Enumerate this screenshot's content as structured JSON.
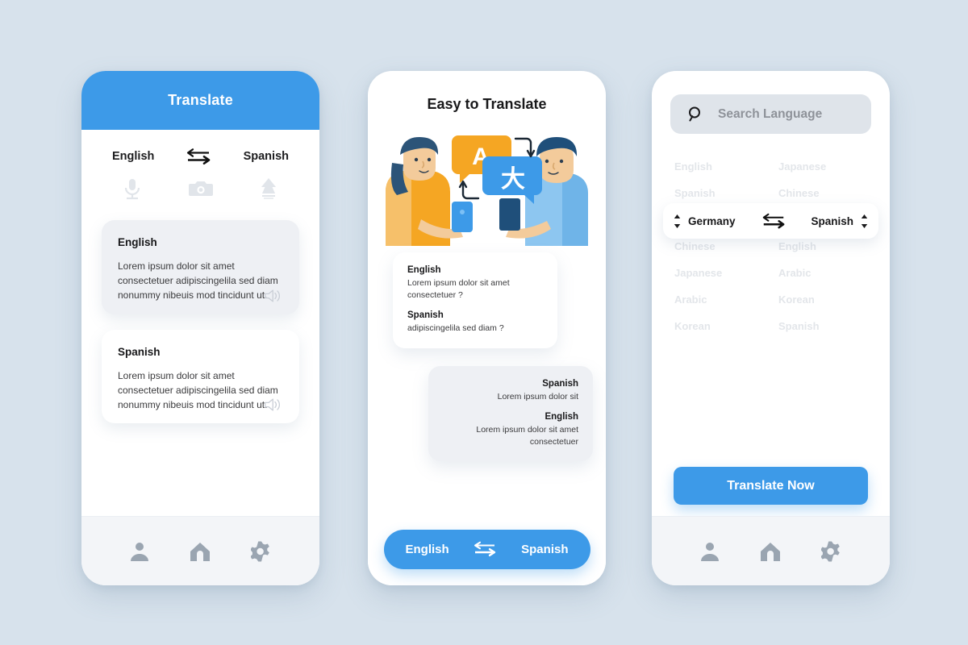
{
  "theme": {
    "background": "#d7e2ec",
    "accent_blue": "#3d9ae8",
    "card_grey": "#eef0f4",
    "muted_text": "#e3e6ea"
  },
  "phone1": {
    "header_title": "Translate",
    "source_language": "English",
    "target_language": "Spanish",
    "swap_icon": "swap-arrows-icon",
    "tools": [
      {
        "icon": "microphone-icon",
        "name": "voice-input"
      },
      {
        "icon": "camera-icon",
        "name": "camera-input"
      },
      {
        "icon": "pen-icon",
        "name": "handwriting-input"
      }
    ],
    "cards": [
      {
        "language": "English",
        "text": "Lorem ipsum dolor sit amet consectetuer adipiscingelila sed diam nonummy nibeuis mod tincidunt ut.",
        "speaker_icon": "speaker-icon",
        "style": "grey"
      },
      {
        "language": "Spanish",
        "text": "Lorem ipsum dolor sit amet consectetuer adipiscingelila sed diam nonummy nibeuis mod tincidunt ut.",
        "speaker_icon": "speaker-icon",
        "style": "white"
      }
    ],
    "nav": [
      {
        "icon": "profile-icon",
        "name": "nav-profile"
      },
      {
        "icon": "home-icon",
        "name": "nav-home"
      },
      {
        "icon": "gear-icon",
        "name": "nav-settings"
      }
    ]
  },
  "phone2": {
    "title": "Easy to Translate",
    "illustration": {
      "name": "two-people-translating-illustration",
      "bubble_left_letter": "A",
      "bubble_right_letter": "大"
    },
    "bubbles": [
      {
        "align": "left",
        "entries": [
          {
            "language": "English",
            "text": "Lorem ipsum dolor sit amet consectetuer ?"
          },
          {
            "language": "Spanish",
            "text": "adipiscingelila sed diam ?"
          }
        ]
      },
      {
        "align": "right",
        "entries": [
          {
            "language": "Spanish",
            "text": "Lorem ipsum dolor sit"
          },
          {
            "language": "English",
            "text": "Lorem ipsum dolor sit amet consectetuer"
          }
        ]
      }
    ],
    "cta": {
      "source_language": "English",
      "target_language": "Spanish",
      "swap_icon": "swap-arrows-icon"
    }
  },
  "phone3": {
    "search": {
      "placeholder": "Search Language",
      "icon": "search-icon"
    },
    "language_rows": [
      {
        "left": "English",
        "right": "Japanese"
      },
      {
        "left": "Spanish",
        "right": "Chinese"
      },
      {
        "left": "Chinese",
        "right": "English"
      },
      {
        "left": "Japanese",
        "right": "Arabic"
      },
      {
        "left": "Arabic",
        "right": "Korean"
      },
      {
        "left": "Korean",
        "right": "Spanish"
      }
    ],
    "selected": {
      "source_language": "Germany",
      "target_language": "Spanish",
      "swap_icon": "swap-arrows-icon",
      "stepper_icon": "up-down-stepper-icon"
    },
    "translate_button_label": "Translate Now",
    "nav": [
      {
        "icon": "profile-icon",
        "name": "nav-profile"
      },
      {
        "icon": "home-icon",
        "name": "nav-home"
      },
      {
        "icon": "gear-icon",
        "name": "nav-settings"
      }
    ]
  }
}
